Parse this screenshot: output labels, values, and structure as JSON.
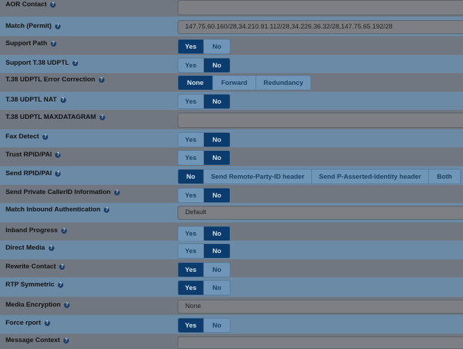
{
  "help_glyph": "?",
  "rows": [
    {
      "label": "AOR Contact",
      "type": "input",
      "value": ""
    },
    {
      "label": "Match (Permit)",
      "type": "input",
      "value": "147.75.60.160/28,34.210.91.112/28,34.226.36.32/28,147.75.65.192/28"
    },
    {
      "label": "Support Path",
      "type": "buttons",
      "options": [
        "Yes",
        "No"
      ],
      "selected": "Yes"
    },
    {
      "label": "Support T.38 UDPTL",
      "type": "buttons",
      "options": [
        "Yes",
        "No"
      ],
      "selected": "No"
    },
    {
      "label": "T.38 UDPTL Error Correction",
      "type": "buttons",
      "options": [
        "None",
        "Forward",
        "Redundancy"
      ],
      "selected": "None"
    },
    {
      "label": "T.38 UDPTL NAT",
      "type": "buttons",
      "options": [
        "Yes",
        "No"
      ],
      "selected": "No"
    },
    {
      "label": "T.38 UDPTL MAXDATAGRAM",
      "type": "input",
      "value": ""
    },
    {
      "label": "Fax Detect",
      "type": "buttons",
      "options": [
        "Yes",
        "No"
      ],
      "selected": "No"
    },
    {
      "label": "Trust RPID/PAI",
      "type": "buttons",
      "options": [
        "Yes",
        "No"
      ],
      "selected": "No"
    },
    {
      "label": "Send RPID/PAI",
      "type": "buttons",
      "options": [
        "No",
        "Send Remote-Party-ID header",
        "Send P-Asserted-Identity header",
        "Both"
      ],
      "selected": "No"
    },
    {
      "label": "Send Private CallerID Information",
      "type": "buttons",
      "options": [
        "Yes",
        "No"
      ],
      "selected": "No"
    },
    {
      "label": "Match Inbound Authentication",
      "type": "input",
      "value": "Default"
    },
    {
      "label": "Inband Progress",
      "type": "buttons",
      "options": [
        "Yes",
        "No"
      ],
      "selected": "No"
    },
    {
      "label": "Direct Media",
      "type": "buttons",
      "options": [
        "Yes",
        "No"
      ],
      "selected": "No"
    },
    {
      "label": "Rewrite Contact",
      "type": "buttons",
      "options": [
        "Yes",
        "No"
      ],
      "selected": "Yes"
    },
    {
      "label": "RTP Symmetric",
      "type": "buttons",
      "options": [
        "Yes",
        "No"
      ],
      "selected": "Yes"
    },
    {
      "label": "Media Encryption",
      "type": "input",
      "value": "None"
    },
    {
      "label": "Force rport",
      "type": "buttons",
      "options": [
        "Yes",
        "No"
      ],
      "selected": "Yes"
    },
    {
      "label": "Message Context",
      "type": "input",
      "value": ""
    }
  ]
}
